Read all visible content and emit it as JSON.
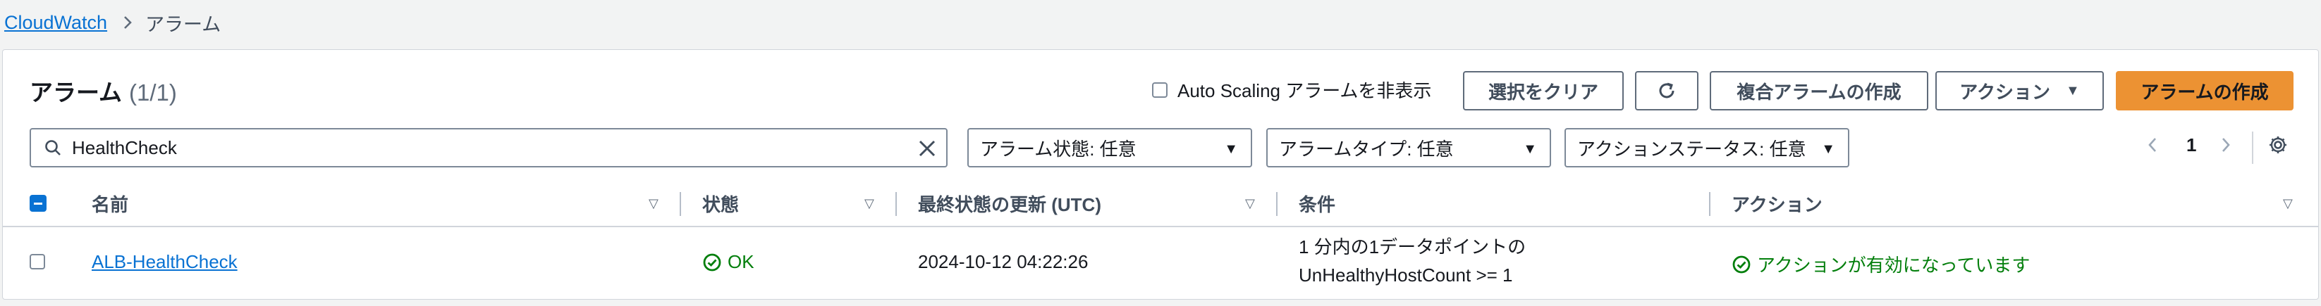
{
  "breadcrumb": {
    "parent": "CloudWatch",
    "current": "アラーム"
  },
  "panel": {
    "title": "アラーム",
    "count": "(1/1)",
    "hide_autoscaling_label": "Auto Scaling アラームを非表示",
    "buttons": {
      "clear_selection": "選択をクリア",
      "create_composite": "複合アラームの作成",
      "actions": "アクション",
      "create_alarm": "アラームの作成"
    }
  },
  "filters": {
    "search_value": "HealthCheck",
    "alarm_state": "アラーム状態: 任意",
    "alarm_type": "アラームタイプ: 任意",
    "action_status": "アクションステータス: 任意"
  },
  "pagination": {
    "current_page": "1"
  },
  "table": {
    "columns": [
      "名前",
      "状態",
      "最終状態の更新 (UTC)",
      "条件",
      "アクション"
    ],
    "rows": [
      {
        "name": "ALB-HealthCheck",
        "state": "OK",
        "last_update": "2024-10-12 04:22:26",
        "condition_line1": "1 分内の1データポイントの",
        "condition_line2": "UnHealthyHostCount >= 1",
        "actions": "アクションが有効になっています"
      }
    ]
  },
  "colors": {
    "link": "#0972d3",
    "primary_button": "#ec9233",
    "status_ok": "#037f0c",
    "page_background": "#f2f3f3"
  }
}
